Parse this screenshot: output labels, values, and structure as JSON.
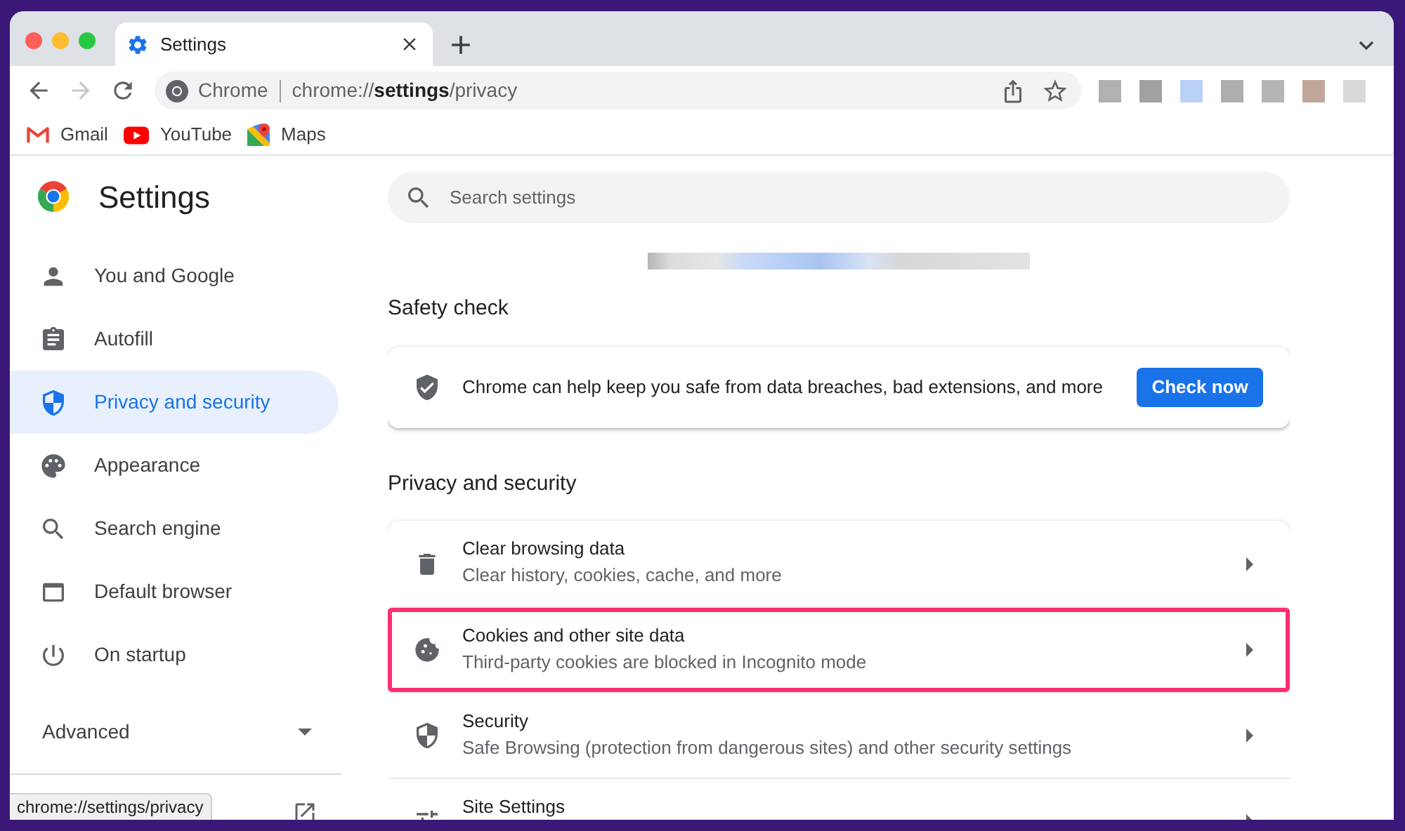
{
  "tabs": [
    {
      "title": "Settings",
      "selected": true
    }
  ],
  "nav_buttons": [
    {
      "kind": "back",
      "disabled": false
    },
    {
      "kind": "forward",
      "disabled": true
    },
    {
      "kind": "reload",
      "disabled": false
    }
  ],
  "omnibox": {
    "site_label": "Chrome",
    "url": "chrome://**settings**/privacy"
  },
  "bookmarks": [
    {
      "label": "Gmail"
    },
    {
      "label": "YouTube"
    },
    {
      "label": "Maps"
    }
  ],
  "sidebar": {
    "title": "Settings",
    "items": [
      {
        "label": "You and Google",
        "selected": false
      },
      {
        "label": "Autofill",
        "selected": false
      },
      {
        "label": "Privacy and security",
        "selected": true
      },
      {
        "label": "Appearance",
        "selected": false
      },
      {
        "label": "Search engine",
        "selected": false
      },
      {
        "label": "Default browser",
        "selected": false
      },
      {
        "label": "On startup",
        "selected": false
      }
    ],
    "advanced": {
      "label": "Advanced",
      "expanded": false
    }
  },
  "search": {
    "placeholder": "Search settings"
  },
  "safety_check": {
    "heading": "Safety check",
    "text": "Chrome can help keep you safe from data breaches, bad extensions, and more",
    "button": "Check now"
  },
  "privacy_and_security": {
    "heading": "Privacy and security",
    "rows": [
      {
        "title": "Clear browsing data",
        "subtitle": "Clear history, cookies, cache, and more",
        "highlighted": false
      },
      {
        "title": "Cookies and other site data",
        "subtitle": "Third-party cookies are blocked in Incognito mode",
        "highlighted": true
      },
      {
        "title": "Security",
        "subtitle": "Safe Browsing (protection from dangerous sites) and other security settings",
        "highlighted": false
      },
      {
        "title": "Site Settings",
        "highlighted": false
      }
    ]
  },
  "status_bubble": {
    "text": "chrome://settings/privacy"
  }
}
